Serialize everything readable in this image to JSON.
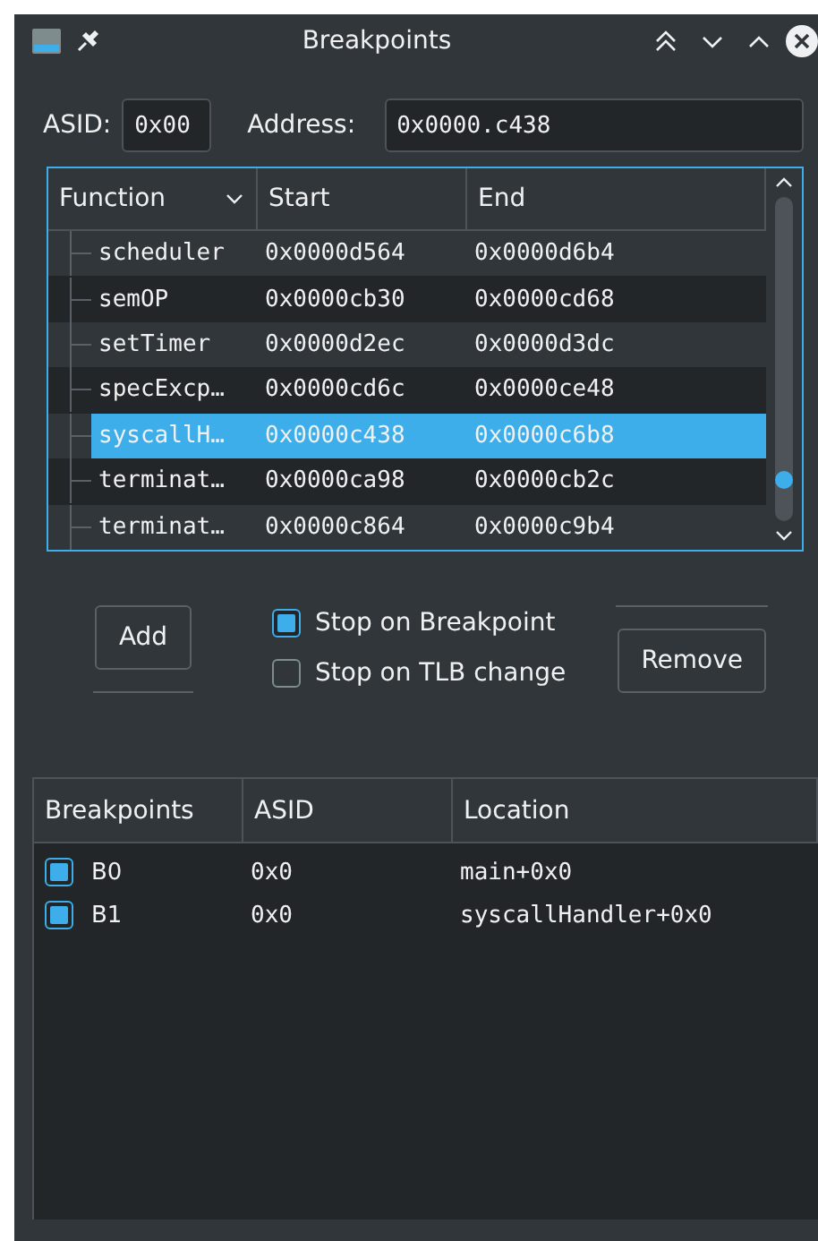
{
  "window": {
    "title": "Breakpoints"
  },
  "asid": {
    "label": "ASID:",
    "value": "0x00"
  },
  "address": {
    "label": "Address:",
    "value": "0x0000.c438"
  },
  "functions": {
    "columns": [
      "Function",
      "Start",
      "End"
    ],
    "rows": [
      {
        "function": "scheduler",
        "start": "0x0000d564",
        "end": "0x0000d6b4",
        "selected": false
      },
      {
        "function": "semOP",
        "start": "0x0000cb30",
        "end": "0x0000cd68",
        "selected": false
      },
      {
        "function": "setTimer",
        "start": "0x0000d2ec",
        "end": "0x0000d3dc",
        "selected": false
      },
      {
        "function": "specExcp…",
        "start": "0x0000cd6c",
        "end": "0x0000ce48",
        "selected": false
      },
      {
        "function": "syscallH…",
        "start": "0x0000c438",
        "end": "0x0000c6b8",
        "selected": true
      },
      {
        "function": "terminat…",
        "start": "0x0000ca98",
        "end": "0x0000cb2c",
        "selected": false
      },
      {
        "function": "terminat…",
        "start": "0x0000c864",
        "end": "0x0000c9b4",
        "selected": false
      }
    ]
  },
  "add_button": "Add",
  "options": [
    {
      "label": "Stop on Breakpoint",
      "checked": true
    },
    {
      "label": "Stop on TLB change",
      "checked": false
    }
  ],
  "remove_button": "Remove",
  "breakpoints": {
    "columns": [
      "Breakpoints",
      "ASID",
      "Location"
    ],
    "rows": [
      {
        "name": "B0",
        "asid": "0x0",
        "location": "main+0x0",
        "checked": true
      },
      {
        "name": "B1",
        "asid": "0x0",
        "location": "syscallHandler+0x0",
        "checked": true
      }
    ]
  }
}
